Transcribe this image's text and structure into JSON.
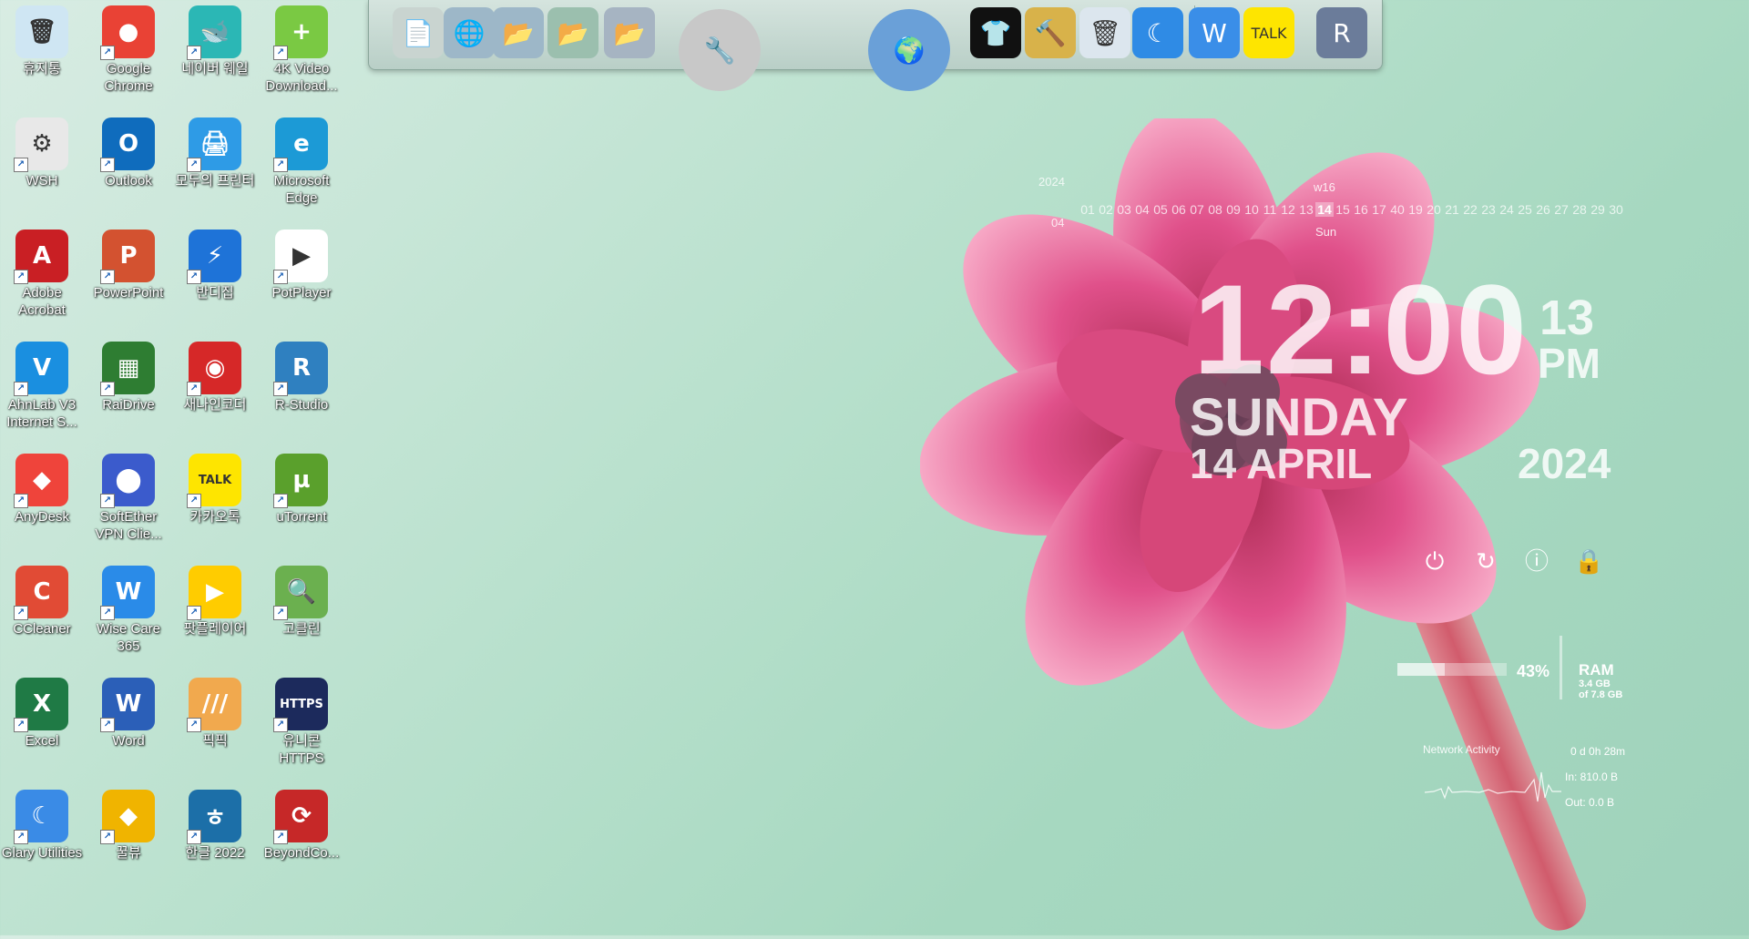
{
  "desktop_icons": [
    {
      "label": "휴지통",
      "glyph": "🗑",
      "color": "#cfe6f3"
    },
    {
      "label": "Google Chrome",
      "glyph": "●",
      "color": "#e94235"
    },
    {
      "label": "네이버 웨일",
      "glyph": "🐋",
      "color": "#2bb7b5"
    },
    {
      "label": "4K Video Download...",
      "glyph": "+",
      "color": "#7ac943"
    },
    {
      "label": "WSH",
      "glyph": "⚙",
      "color": "#e8e8e8"
    },
    {
      "label": "Outlook",
      "glyph": "O",
      "color": "#0f6cbd"
    },
    {
      "label": "모두의 프린터",
      "glyph": "🖨",
      "color": "#2e9be6"
    },
    {
      "label": "Microsoft Edge",
      "glyph": "e",
      "color": "#1c9ad6"
    },
    {
      "label": "Adobe Acrobat",
      "glyph": "A",
      "color": "#c91f24"
    },
    {
      "label": "PowerPoint",
      "glyph": "P",
      "color": "#d35230"
    },
    {
      "label": "반디집",
      "glyph": "⚡",
      "color": "#1e73d8"
    },
    {
      "label": "PotPlayer",
      "glyph": "▶",
      "color": "#ffffff"
    },
    {
      "label": "AhnLab V3 Internet S...",
      "glyph": "V",
      "color": "#1a8fe0"
    },
    {
      "label": "RaiDrive",
      "glyph": "▦",
      "color": "#2e7d32"
    },
    {
      "label": "새나인코더",
      "glyph": "◉",
      "color": "#d62828"
    },
    {
      "label": "R-Studio",
      "glyph": "R",
      "color": "#2f80c0"
    },
    {
      "label": "AnyDesk",
      "glyph": "◆",
      "color": "#ef443b"
    },
    {
      "label": "SoftEther VPN Clie...",
      "glyph": "⬤",
      "color": "#3b5bcc"
    },
    {
      "label": "카카오톡",
      "glyph": "TALK",
      "color": "#fee500"
    },
    {
      "label": "uTorrent",
      "glyph": "µ",
      "color": "#5aa02c"
    },
    {
      "label": "CCleaner",
      "glyph": "C",
      "color": "#e14b35"
    },
    {
      "label": "Wise Care 365",
      "glyph": "W",
      "color": "#2a8be8"
    },
    {
      "label": "팟플레이어",
      "glyph": "▶",
      "color": "#ffcc00"
    },
    {
      "label": "고클린",
      "glyph": "🔍",
      "color": "#6bb04f"
    },
    {
      "label": "Excel",
      "glyph": "X",
      "color": "#1f7a45"
    },
    {
      "label": "Word",
      "glyph": "W",
      "color": "#2b5fb8"
    },
    {
      "label": "픽픽",
      "glyph": "///",
      "color": "#f1a94e"
    },
    {
      "label": "유니콘 HTTPS",
      "glyph": "HTTPS",
      "color": "#1c2a5c"
    },
    {
      "label": "Glary Utilities",
      "glyph": "☾",
      "color": "#3a8be6"
    },
    {
      "label": "꿀뷰",
      "glyph": "◆",
      "color": "#f0b400"
    },
    {
      "label": "한글 2022",
      "glyph": "ㅎ",
      "color": "#1c6fa8"
    },
    {
      "label": "BeyondCo...",
      "glyph": "⟳",
      "color": "#c62828"
    }
  ],
  "dock_items": [
    {
      "name": "document-viewer-icon",
      "glyph": "📄",
      "color": "#c9d4d0"
    },
    {
      "name": "network-globe-icon",
      "glyph": "🌐",
      "color": "#9db7c8"
    },
    {
      "name": "folder-icon",
      "glyph": "📂",
      "color": "#9db7c8"
    },
    {
      "name": "folder-green-icon",
      "glyph": "📂",
      "color": "#9bbfae"
    },
    {
      "name": "folder-open-icon",
      "glyph": "📂",
      "color": "#a6b4c2"
    },
    {
      "name": "tools-icon",
      "glyph": "🔧",
      "color": "#c8c8c8"
    },
    {
      "name": "globe-icon",
      "glyph": "🌍",
      "color": "#6aa0d8"
    },
    {
      "name": "tshirt-icon",
      "glyph": "👕",
      "color": "#111111"
    },
    {
      "name": "hammer-icon",
      "glyph": "🔨",
      "color": "#d8b24a"
    },
    {
      "name": "recycle-bin-icon",
      "glyph": "🗑",
      "color": "#dce6ee"
    },
    {
      "name": "glary-icon",
      "glyph": "☾",
      "color": "#2f8be5"
    },
    {
      "name": "wise-care-icon",
      "glyph": "W",
      "color": "#3a8ee8"
    },
    {
      "name": "kakaotalk-icon",
      "glyph": "TALK",
      "color": "#fee500"
    },
    {
      "name": "r-app-icon",
      "glyph": "R",
      "color": "#6b7c9a"
    }
  ],
  "calendar": {
    "year": "2024",
    "month": "04",
    "week": "w16",
    "day_of_week": "Sun",
    "days": [
      "01",
      "02",
      "03",
      "04",
      "05",
      "06",
      "07",
      "08",
      "09",
      "10",
      "11",
      "12",
      "13",
      "14",
      "15",
      "16",
      "17",
      "40",
      "19",
      "20",
      "21",
      "22",
      "23",
      "24",
      "25",
      "26",
      "27",
      "28",
      "29",
      "30"
    ],
    "today": "14"
  },
  "clock": {
    "time": "12:00",
    "seconds": "13",
    "ampm": "PM",
    "day_name": "SUNDAY",
    "date": "14 APRIL",
    "year": "2024"
  },
  "power_buttons": [
    {
      "name": "shutdown-icon",
      "glyph": "⏻"
    },
    {
      "name": "restart-icon",
      "glyph": "↻"
    },
    {
      "name": "info-icon",
      "glyph": "ⓘ"
    },
    {
      "name": "lock-icon",
      "glyph": "🔒"
    }
  ],
  "ram": {
    "percent": "43%",
    "fill": 0.43,
    "label": "RAM",
    "used": "3.4 GB",
    "total": "of 7.8 GB"
  },
  "network": {
    "title": "Network Activity",
    "uptime": "0 d 0h 28m",
    "in": "In: 810.0 B",
    "out": "Out: 0.0 B"
  },
  "colors": {
    "background": "#b7e0cc",
    "flower_pink": "#e4568a",
    "stem": "#d9465e"
  }
}
